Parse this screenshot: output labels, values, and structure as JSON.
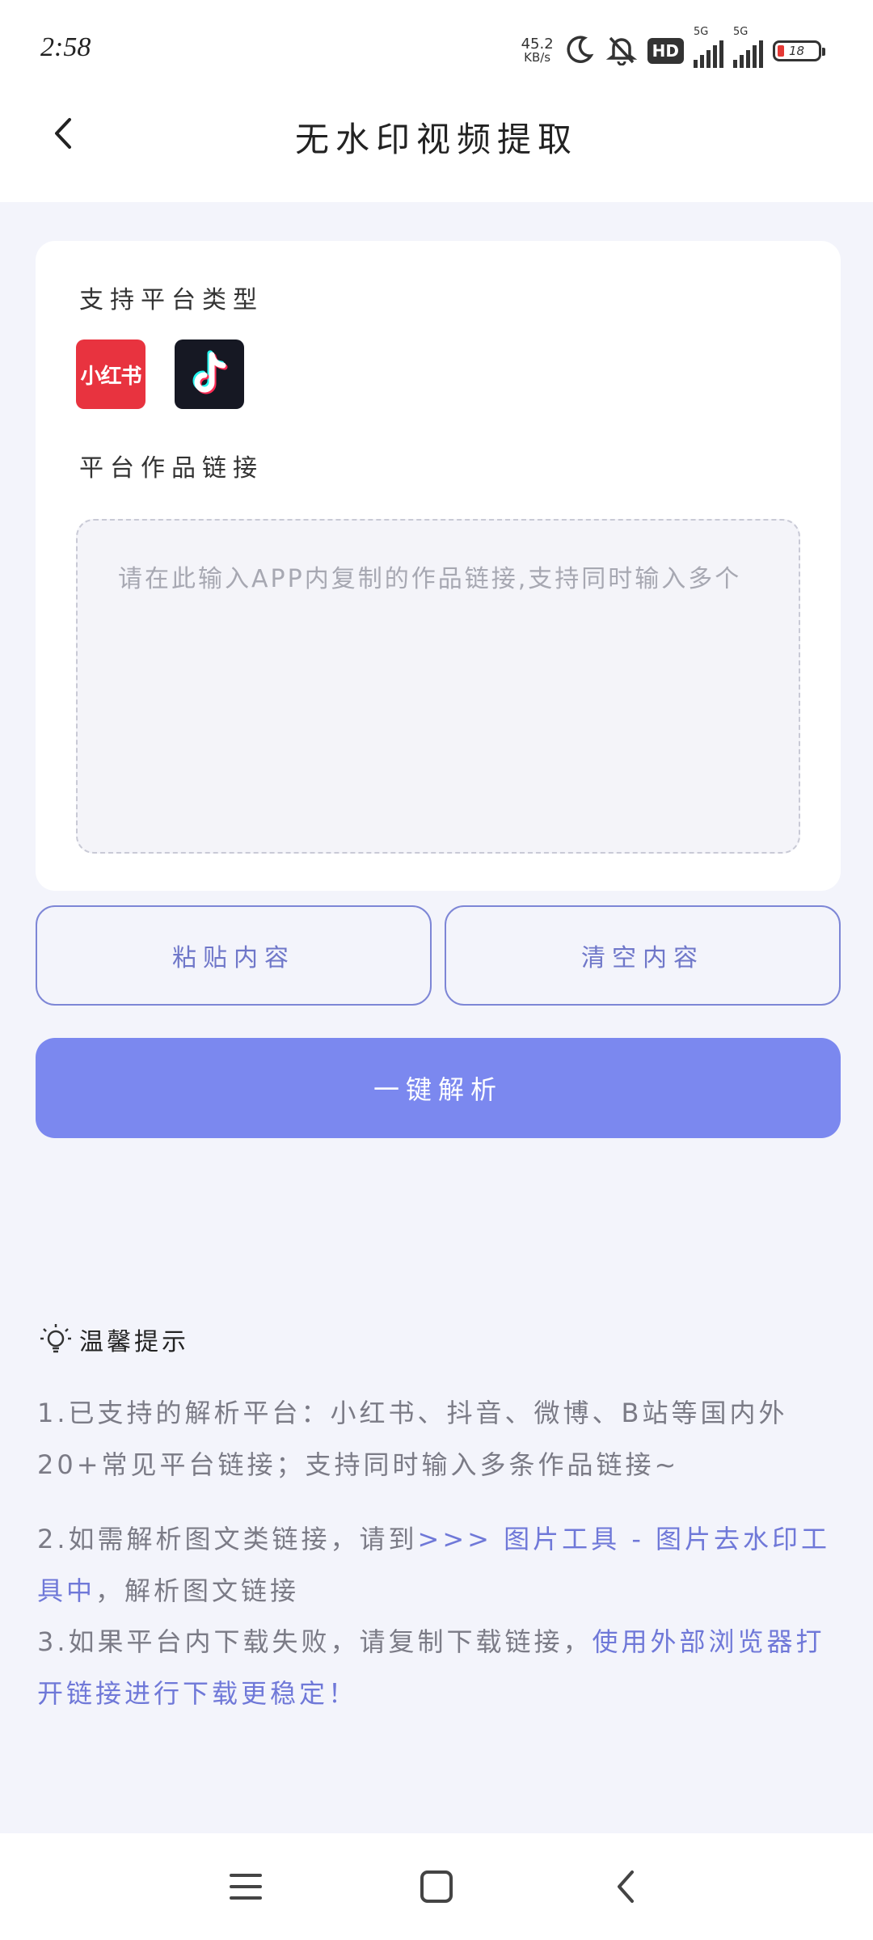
{
  "status_bar": {
    "time": "2:58",
    "net_speed_value": "45.2",
    "net_speed_unit": "KB/s",
    "hd_badge": "HD",
    "signal1_label": "5G",
    "signal2_label": "5G",
    "battery_level": "18"
  },
  "header": {
    "title": "无水印视频提取"
  },
  "card": {
    "platform_label": "支持平台类型",
    "platforms": [
      {
        "name": "小红书"
      },
      {
        "name": "TikTok"
      }
    ],
    "link_label": "平台作品链接",
    "link_placeholder": "请在此输入APP内复制的作品链接,支持同时输入多个",
    "link_value": ""
  },
  "actions": {
    "paste_label": "粘贴内容",
    "clear_label": "清空内容",
    "parse_label": "一键解析"
  },
  "tips": {
    "title": "温馨提示",
    "tip1": "1.已支持的解析平台：小红书、抖音、微博、B站等国内外20+常见平台链接；支持同时输入多条作品链接~",
    "tip2_prefix": "2.如需解析图文类链接，请到",
    "tip2_link": ">>> 图片工具 - 图片去水印工具中",
    "tip2_suffix": "，解析图文链接",
    "tip3_prefix": "3.如果平台内下载失败，请复制下载链接，",
    "tip3_highlight": "使用外部浏览器打开链接进行下载更稳定！"
  },
  "colors": {
    "accent": "#7b88ef",
    "accent_text": "#6f78d8",
    "background": "#f3f4fb",
    "xhs_red": "#e8333f",
    "tiktok_dark": "#161823"
  },
  "icons": {
    "back": "chevron-left-icon",
    "tips": "lightbulb-icon",
    "nav_menu": "menu-icon",
    "nav_home": "square-home-icon",
    "nav_back": "chevron-left-icon"
  }
}
